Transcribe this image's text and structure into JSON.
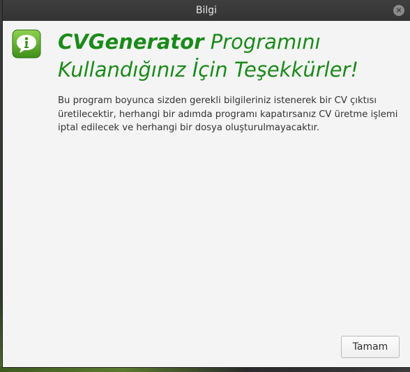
{
  "window": {
    "title": "Bilgi",
    "close_glyph": "×"
  },
  "dialog": {
    "icon": "info-speech-bubble-icon",
    "heading_bold": "CVGenerator",
    "heading_rest_line1": " Programını",
    "heading_line2": "Kullandığınız İçin Teşekkürler!",
    "message": "Bu program boyunca sizden gerekli bilgileriniz istenerek bir CV çıktısı üretilecektir, herhangi bir adımda programı kapatırsanız CV üretme işlemi iptal edilecek ve herhangi bir dosya oluşturulmayacaktır.",
    "ok_label": "Tamam"
  },
  "colors": {
    "accent_green": "#1a8a1a",
    "titlebar": "#383838"
  }
}
